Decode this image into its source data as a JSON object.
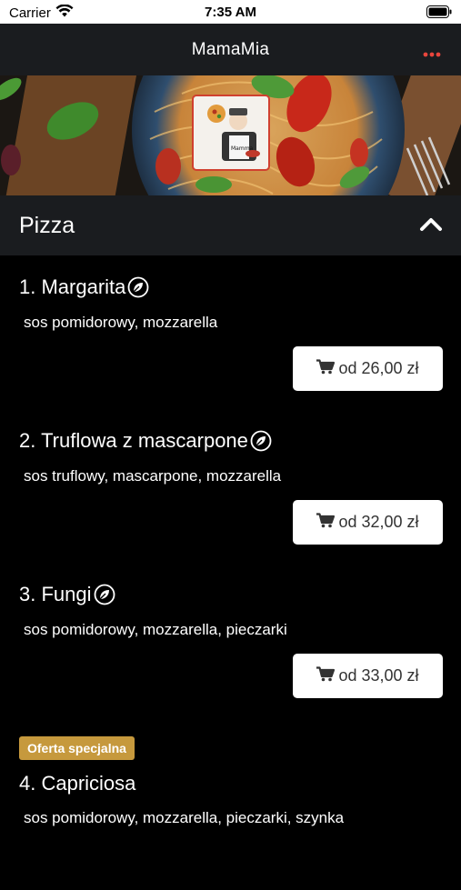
{
  "status_bar": {
    "carrier": "Carrier",
    "time": "7:35 AM"
  },
  "nav": {
    "title": "MamaMia",
    "more_icon": "more-horizontal-icon",
    "accent_color": "#e8453c"
  },
  "banner": {
    "image": "pasta-plate-with-tomatoes-and-basil",
    "logo": "mamamia-chef-logo"
  },
  "section": {
    "title": "Pizza",
    "expanded": true,
    "toggle_icon": "chevron-up-icon"
  },
  "items": [
    {
      "name": "1. Margarita",
      "description": "sos pomidorowy, mozzarella",
      "price": "od 26,00 zł",
      "vegetarian": true
    },
    {
      "name": "2. Truflowa z mascarpone",
      "description": "sos truflowy, mascarpone, mozzarella",
      "price": "od 32,00 zł",
      "vegetarian": true
    },
    {
      "name": "3. Fungi",
      "description": "sos pomidorowy, mozzarella, pieczarki",
      "price": "od 33,00 zł",
      "vegetarian": true
    },
    {
      "badge": "Oferta specjalna",
      "name": "4. Capriciosa",
      "description": "sos pomidorowy, mozzarella, pieczarki, szynka"
    }
  ],
  "colors": {
    "background": "#000000",
    "header_bg": "#1a1c1f",
    "badge": "#c6993d",
    "button_bg": "#ffffff"
  }
}
